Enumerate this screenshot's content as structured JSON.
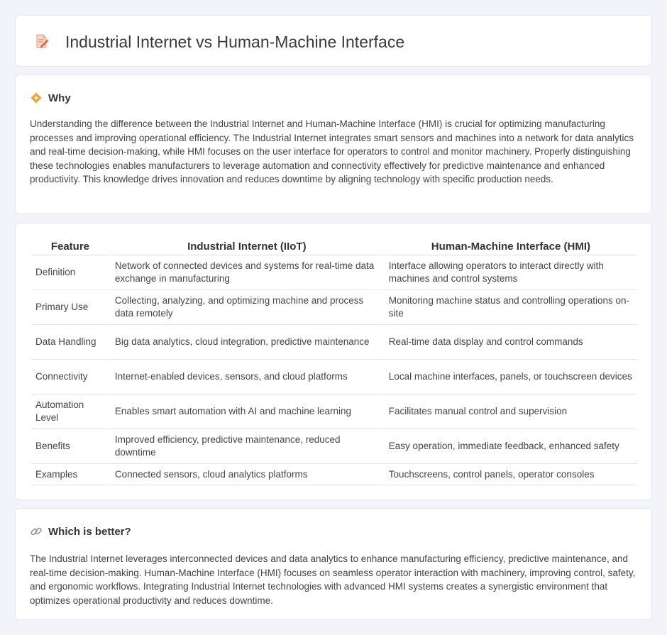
{
  "header": {
    "title": "Industrial Internet vs Human-Machine Interface",
    "icon": "document-pencil-icon"
  },
  "why": {
    "title": "Why",
    "icon": "diamond-sparkle-icon",
    "text": "Understanding the difference between the Industrial Internet and Human-Machine Interface (HMI) is crucial for optimizing manufacturing processes and improving operational efficiency. The Industrial Internet integrates smart sensors and machines into a network for data analytics and real-time decision-making, while HMI focuses on the user interface for operators to control and monitor machinery. Properly distinguishing these technologies enables manufacturers to leverage automation and connectivity effectively for predictive maintenance and enhanced productivity. This knowledge drives innovation and reduces downtime by aligning technology with specific production needs."
  },
  "table": {
    "headers": [
      "Feature",
      "Industrial Internet (IIoT)",
      "Human-Machine Interface (HMI)"
    ],
    "rows": [
      [
        "Definition",
        "Network of connected devices and systems for real-time data exchange in manufacturing",
        "Interface allowing operators to interact directly with machines and control systems"
      ],
      [
        "Primary Use",
        "Collecting, analyzing, and optimizing machine and process data remotely",
        "Monitoring machine status and controlling operations on-site"
      ],
      [
        "Data Handling",
        "Big data analytics, cloud integration, predictive maintenance",
        "Real-time data display and control commands"
      ],
      [
        "Connectivity",
        "Internet-enabled devices, sensors, and cloud platforms",
        "Local machine interfaces, panels, or touchscreen devices"
      ],
      [
        "Automation Level",
        "Enables smart automation with AI and machine learning",
        "Facilitates manual control and supervision"
      ],
      [
        "Benefits",
        "Improved efficiency, predictive maintenance, reduced downtime",
        "Easy operation, immediate feedback, enhanced safety"
      ],
      [
        "Examples",
        "Connected sensors, cloud analytics platforms",
        "Touchscreens, control panels, operator consoles"
      ]
    ]
  },
  "better": {
    "title": "Which is better?",
    "icon": "link-icon",
    "text": "The Industrial Internet leverages interconnected devices and data analytics to enhance manufacturing efficiency, predictive maintenance, and real-time decision-making. Human-Machine Interface (HMI) focuses on seamless operator interaction with machinery, improving control, safety, and ergonomic workflows. Integrating Industrial Internet technologies with advanced HMI systems creates a synergistic environment that optimizes operational productivity and reduces downtime."
  }
}
